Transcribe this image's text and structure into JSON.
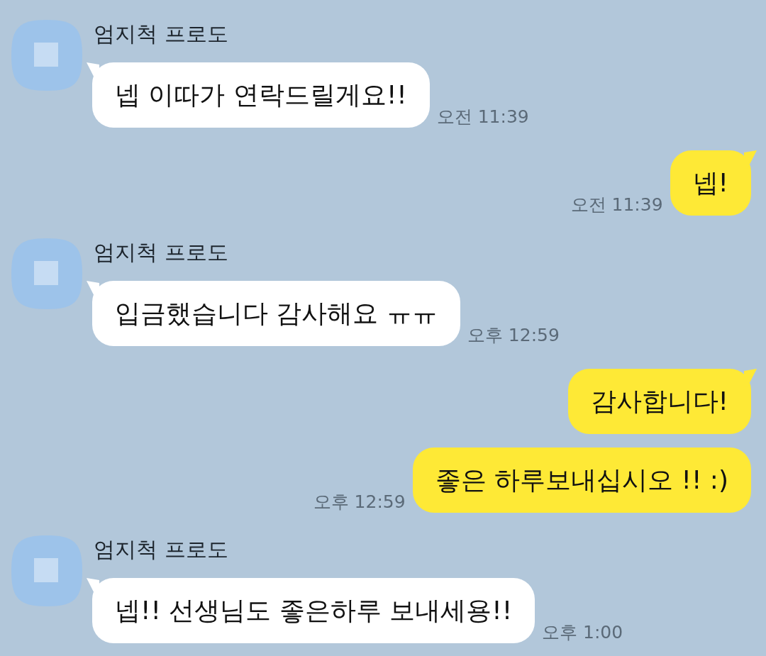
{
  "chat": [
    {
      "kind": "received",
      "sender": "엄지척 프로도",
      "bubbles": [
        {
          "text": "넵 이따가 연락드릴게요!!",
          "time": "오전 11:39"
        }
      ]
    },
    {
      "kind": "sent",
      "bubbles": [
        {
          "text": "넵!",
          "time": "오전 11:39"
        }
      ]
    },
    {
      "kind": "received",
      "sender": "엄지척 프로도",
      "bubbles": [
        {
          "text": "입금했습니다 감사해요 ㅠㅠ",
          "time": "오후 12:59"
        }
      ]
    },
    {
      "kind": "sent",
      "bubbles": [
        {
          "text": "감사합니다!"
        },
        {
          "text": "좋은 하루보내십시오 !! :)",
          "time": "오후 12:59"
        }
      ]
    },
    {
      "kind": "received",
      "sender": "엄지척 프로도",
      "bubbles": [
        {
          "text": "넵!! 선생님도 좋은하루 보내세용!!",
          "time": "오후 1:00"
        }
      ]
    }
  ]
}
